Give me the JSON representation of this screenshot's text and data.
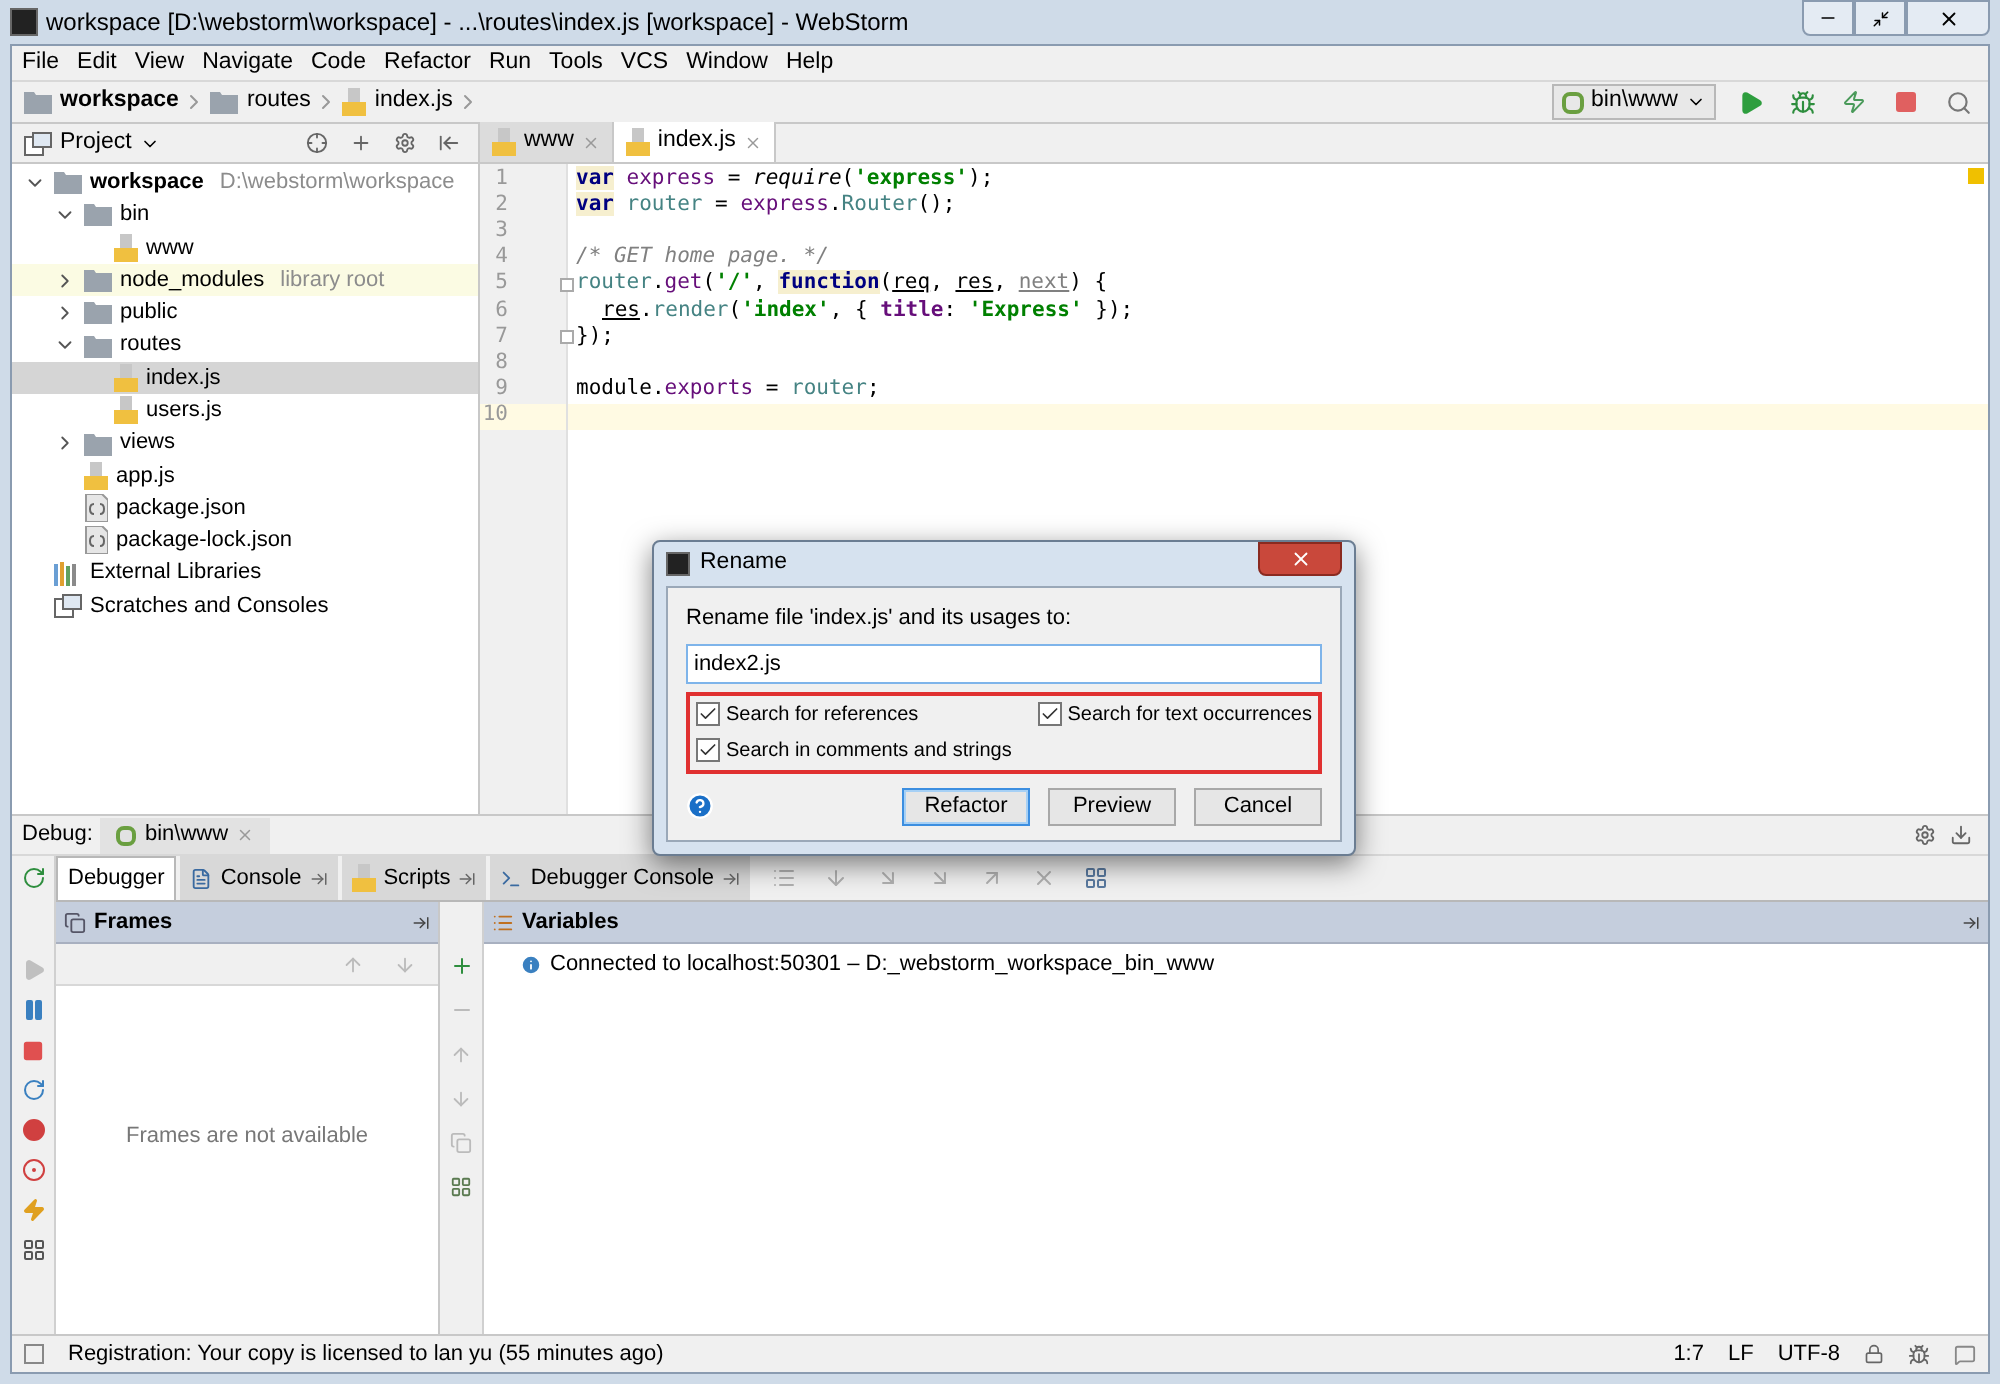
{
  "window": {
    "title": "workspace [D:\\webstorm\\workspace] - ...\\routes\\index.js [workspace] - WebStorm"
  },
  "menu": [
    "File",
    "Edit",
    "View",
    "Navigate",
    "Code",
    "Refactor",
    "Run",
    "Tools",
    "VCS",
    "Window",
    "Help"
  ],
  "breadcrumbs": [
    {
      "label": "workspace",
      "kind": "root"
    },
    {
      "label": "routes",
      "kind": "folder"
    },
    {
      "label": "index.js",
      "kind": "js"
    }
  ],
  "run_config": "bin\\www",
  "project_panel": {
    "title": "Project",
    "tree": [
      {
        "label": "workspace",
        "kind": "root",
        "hint": "D:\\webstorm\\workspace",
        "expanded": true,
        "selected": false,
        "children": [
          {
            "label": "bin",
            "kind": "folder",
            "expanded": true,
            "selected": false,
            "children": [
              {
                "label": "www",
                "kind": "js",
                "selected": false
              }
            ]
          },
          {
            "label": "node_modules",
            "kind": "library",
            "hint": "library root",
            "expanded": false,
            "selected": false
          },
          {
            "label": "public",
            "kind": "folder",
            "expanded": false,
            "selected": false
          },
          {
            "label": "routes",
            "kind": "folder",
            "expanded": true,
            "selected": false,
            "children": [
              {
                "label": "index.js",
                "kind": "js",
                "selected": true
              },
              {
                "label": "users.js",
                "kind": "js",
                "selected": false
              }
            ]
          },
          {
            "label": "views",
            "kind": "folder",
            "expanded": false,
            "selected": false
          },
          {
            "label": "app.js",
            "kind": "js",
            "selected": false
          },
          {
            "label": "package.json",
            "kind": "json",
            "selected": false
          },
          {
            "label": "package-lock.json",
            "kind": "json",
            "selected": false
          }
        ]
      },
      {
        "label": "External Libraries",
        "kind": "libraries",
        "selected": false
      },
      {
        "label": "Scratches and Consoles",
        "kind": "scratches",
        "selected": false
      }
    ]
  },
  "editor": {
    "tabs": [
      {
        "label": "www",
        "selected": false
      },
      {
        "label": "index.js",
        "selected": true
      }
    ],
    "lines": [
      {
        "number": "1",
        "current": false,
        "fold": false,
        "tokens": [
          {
            "t": "var",
            "kind": "keyword"
          },
          {
            "t": " express",
            "kind": "variable"
          },
          {
            "t": " = ",
            "kind": "plain"
          },
          {
            "t": "require",
            "kind": "call"
          },
          {
            "t": "(",
            "kind": "plain"
          },
          {
            "t": "'express'",
            "kind": "string"
          },
          {
            "t": ");",
            "kind": "plain"
          }
        ]
      },
      {
        "number": "2",
        "current": false,
        "fold": false,
        "tokens": [
          {
            "t": "var",
            "kind": "keyword"
          },
          {
            "t": " router",
            "kind": "global"
          },
          {
            "t": " = ",
            "kind": "plain"
          },
          {
            "t": "express",
            "kind": "variable"
          },
          {
            "t": ".",
            "kind": "plain"
          },
          {
            "t": "Router",
            "kind": "global"
          },
          {
            "t": "();",
            "kind": "plain"
          }
        ]
      },
      {
        "number": "3",
        "current": false,
        "fold": false
      },
      {
        "number": "4",
        "current": false,
        "fold": false,
        "tokens": [
          {
            "t": "/* GET home page. */",
            "kind": "comment"
          }
        ]
      },
      {
        "number": "5",
        "current": false,
        "fold": true,
        "tokens": [
          {
            "t": "router",
            "kind": "global"
          },
          {
            "t": ".",
            "kind": "plain"
          },
          {
            "t": "get",
            "kind": "variable"
          },
          {
            "t": "(",
            "kind": "plain"
          },
          {
            "t": "'/'",
            "kind": "string"
          },
          {
            "t": ", ",
            "kind": "plain"
          },
          {
            "t": "function",
            "kind": "keyword"
          },
          {
            "t": "(",
            "kind": "plain"
          },
          {
            "t": "req",
            "kind": "param"
          },
          {
            "t": ", ",
            "kind": "plain"
          },
          {
            "t": "res",
            "kind": "param"
          },
          {
            "t": ", ",
            "kind": "plain"
          },
          {
            "t": "next",
            "kind": "unused"
          },
          {
            "t": ") {",
            "kind": "plain"
          }
        ]
      },
      {
        "number": "6",
        "current": false,
        "fold": false,
        "indented": true,
        "tokens": [
          {
            "t": "res",
            "kind": "param"
          },
          {
            "t": ".",
            "kind": "plain"
          },
          {
            "t": "render",
            "kind": "global"
          },
          {
            "t": "(",
            "kind": "plain"
          },
          {
            "t": "'index'",
            "kind": "string"
          },
          {
            "t": ", { ",
            "kind": "plain"
          },
          {
            "t": "title",
            "kind": "property"
          },
          {
            "t": ": ",
            "kind": "plain"
          },
          {
            "t": "'Express'",
            "kind": "string"
          },
          {
            "t": " });",
            "kind": "plain"
          }
        ]
      },
      {
        "number": "7",
        "current": false,
        "fold": true,
        "tokens": [
          {
            "t": "});",
            "kind": "plain"
          }
        ]
      },
      {
        "number": "8",
        "current": false,
        "fold": false
      },
      {
        "number": "9",
        "current": false,
        "fold": false,
        "tokens": [
          {
            "t": "module",
            "kind": "plain"
          },
          {
            "t": ".",
            "kind": "plain"
          },
          {
            "t": "exports",
            "kind": "variable"
          },
          {
            "t": " = ",
            "kind": "plain"
          },
          {
            "t": "router",
            "kind": "global"
          },
          {
            "t": ";",
            "kind": "plain"
          }
        ]
      },
      {
        "number": "10",
        "current": true,
        "fold": false
      }
    ]
  },
  "debug": {
    "label": "Debug:",
    "session": "bin\\www",
    "tabs": [
      {
        "label": "Debugger",
        "selected": true
      },
      {
        "label": "Console",
        "selected": false
      },
      {
        "label": "Scripts",
        "selected": false
      },
      {
        "label": "Debugger Console",
        "selected": false
      }
    ],
    "frames": {
      "title": "Frames",
      "empty_text": "Frames are not available"
    },
    "variables": {
      "title": "Variables",
      "message": "Connected to localhost:50301 – D:_webstorm_workspace_bin_www"
    }
  },
  "status_bar": {
    "message": "Registration: Your copy is licensed to lan yu (55 minutes ago)",
    "position": "1:7",
    "line_ending": "LF",
    "encoding": "UTF-8"
  },
  "dialog": {
    "title": "Rename",
    "prompt": "Rename file 'index.js' and its usages to:",
    "value": "index2.js",
    "options": [
      {
        "label": "Search for references",
        "checked": true
      },
      {
        "label": "Search for text occurrences",
        "checked": true
      },
      {
        "label": "Search in comments and strings",
        "checked": true
      }
    ],
    "buttons": [
      {
        "label": "Refactor",
        "kind": "default"
      },
      {
        "label": "Preview",
        "kind": "normal"
      },
      {
        "label": "Cancel",
        "kind": "normal"
      }
    ]
  }
}
